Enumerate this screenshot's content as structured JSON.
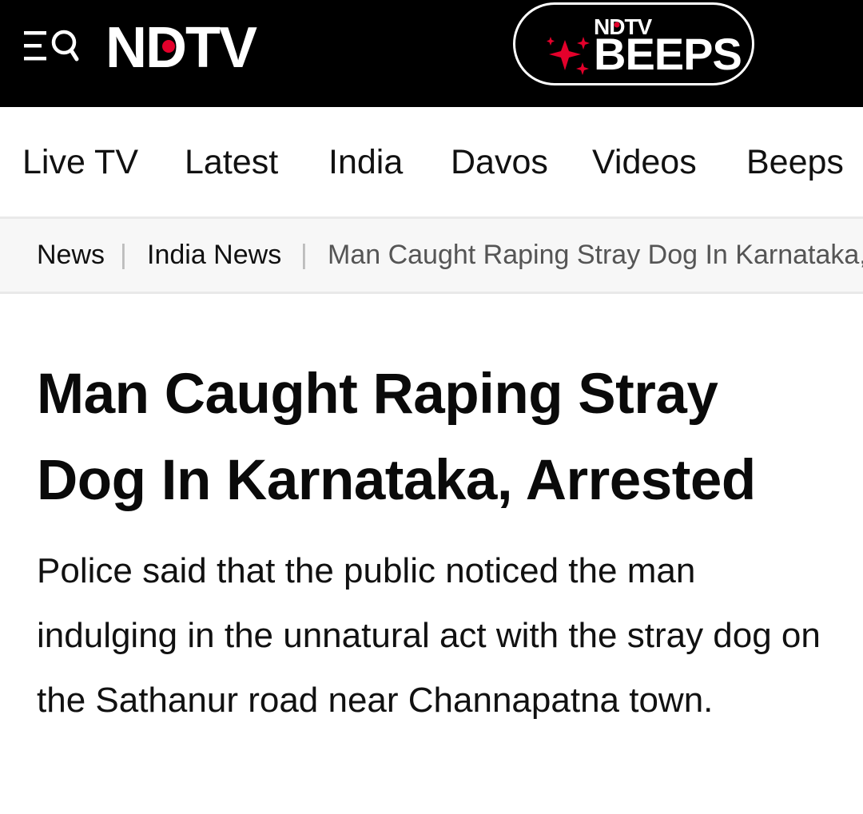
{
  "header": {
    "logo_text": "NDTV",
    "beeps": {
      "brand_small": "NDTV",
      "label": "BEEPS"
    },
    "colors": {
      "background": "#000000",
      "accent_red": "#e4002b",
      "text": "#ffffff"
    },
    "icons": [
      "menu-search-icon",
      "sparkle-icon"
    ]
  },
  "nav": {
    "items": [
      {
        "label": "Live TV"
      },
      {
        "label": "Latest"
      },
      {
        "label": "India"
      },
      {
        "label": "Davos"
      },
      {
        "label": "Videos"
      },
      {
        "label": "Beeps"
      }
    ]
  },
  "breadcrumb": {
    "items": [
      {
        "label": "News"
      },
      {
        "label": "India News"
      }
    ],
    "current": "Man Caught Raping Stray Dog In Karnataka, Arrested"
  },
  "article": {
    "headline": "Man Caught Raping Stray Dog In Karnataka, Arrested",
    "summary": "Police said that the public noticed the man indulging in the unnatural act with the stray dog on the Sathanur road near Channapatna town."
  }
}
